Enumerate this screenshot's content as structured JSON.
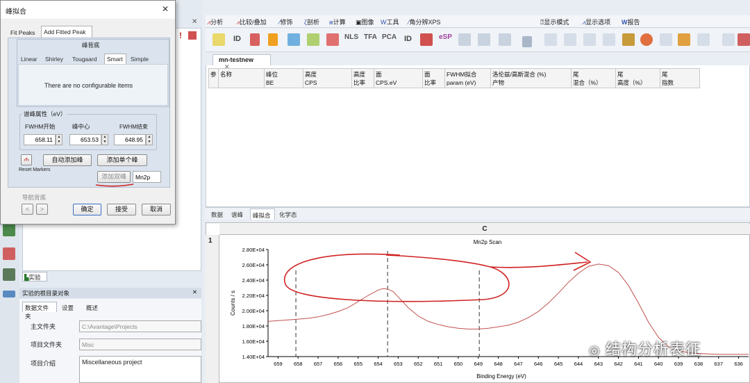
{
  "dialog": {
    "title": "峰拟合",
    "tabs": [
      "Fit Peaks",
      "Add Fitted Peak"
    ],
    "group_title": "峰背底",
    "bg_tabs": [
      "Linear",
      "Shirley",
      "Tougaard",
      "Smart",
      "Simple"
    ],
    "no_items": "There are no configurable items",
    "peak_props": "谱峰属性（eV）",
    "fwhm_start_label": "FWHM开始",
    "center_label": "峰中心",
    "fwhm_end_label": "FWHM结束",
    "fwhm_start": "658.11",
    "center": "653.53",
    "fwhm_end": "648.95",
    "reset_markers": "Reset Markers",
    "auto_add": "自动添加峰",
    "add_single": "添加单个峰",
    "add_double": "添加双峰",
    "peak_name": "Mn2p",
    "nav_bg": "导航背底",
    "ok": "确定",
    "accept": "接受",
    "cancel": "取消"
  },
  "menu": {
    "items": [
      "分析",
      "比较/叠加",
      "修饰",
      "剖析",
      "计算",
      "图像",
      "工具",
      "角分辨XPS",
      "显示模式",
      "显示选项",
      "报告"
    ]
  },
  "toolbar_labels": [
    "ID",
    "NLS",
    "TFA",
    "PCA",
    "ID",
    "eSP"
  ],
  "doc_tab": "mn-testnew",
  "table": {
    "headers": [
      "参",
      "名称",
      "峰位\nBE",
      "高度\nCPS",
      "高度\n比率",
      "面\nCPS.eV",
      "面\n比率",
      "FWHM拟合\nparam (eV)",
      "洛伦兹/高斯混合 (%)\n产物",
      "尾\n混合（%）",
      "尾\n高度（%）",
      "尾\n指数"
    ]
  },
  "bottom_tabs": [
    "数据",
    "谱峰",
    "峰拟合",
    "化学态"
  ],
  "chart_panel": {
    "column_label": "C",
    "row_label": "1"
  },
  "left_panel": {
    "experiment_tab": "实验",
    "title": "实验的根目录对象",
    "tabs": [
      "数据文件夹",
      "设置",
      "概述"
    ],
    "main_folder_label": "主文件夹",
    "main_folder_value": "C:\\Avantage\\Projects",
    "project_folder_label": "项目文件夹",
    "project_folder_value": "Misc",
    "project_desc_label": "项目介绍",
    "project_desc_value": "Miscellaneous project"
  },
  "watermark": "结构分析表征",
  "chart_data": {
    "type": "line",
    "title": "Mn2p Scan",
    "xlabel": "Binding Energy (eV)",
    "ylabel": "Counts / s",
    "xlim": [
      659.5,
      635.5
    ],
    "ylim": [
      14000,
      28000
    ],
    "x_ticks": [
      659,
      658,
      657,
      656,
      655,
      654,
      653,
      652,
      651,
      650,
      649,
      648,
      647,
      646,
      645,
      644,
      643,
      642,
      641,
      640,
      639,
      638,
      637,
      636
    ],
    "y_ticks": [
      "1.40E+04",
      "1.60E+04",
      "1.80E+04",
      "2.00E+04",
      "2.20E+04",
      "2.40E+04",
      "2.60E+04",
      "2.80E+04"
    ],
    "series": [
      {
        "color": "#c0504d",
        "x": [
          659.5,
          659,
          658.5,
          658,
          657.5,
          657,
          656.5,
          656,
          655.5,
          655,
          654.5,
          654,
          653.75,
          653.5,
          653.25,
          653,
          652.5,
          652,
          651.5,
          651,
          650.5,
          650,
          649.5,
          649,
          648.5,
          648,
          647.5,
          647,
          646.5,
          646,
          645.5,
          645,
          644.5,
          644,
          643.5,
          643,
          642.5,
          642,
          641.5,
          641,
          640.5,
          640,
          639.5,
          639,
          638.5,
          638,
          637.5,
          637,
          636.5,
          636,
          635.5
        ],
        "y": [
          18600,
          18700,
          18800,
          18900,
          19000,
          19200,
          19500,
          19900,
          20400,
          21200,
          22000,
          22700,
          22900,
          22800,
          22500,
          21800,
          20400,
          19300,
          18600,
          18200,
          17900,
          17700,
          17600,
          17600,
          17700,
          17900,
          18100,
          18500,
          19100,
          19900,
          21000,
          22300,
          23700,
          24900,
          25800,
          26100,
          25900,
          25000,
          23300,
          21000,
          18500,
          16500,
          15300,
          14800,
          14500,
          14400,
          14350,
          14300,
          14300,
          14300,
          14300
        ]
      }
    ],
    "markers_x": [
      658.11,
      653.53,
      648.95
    ]
  }
}
